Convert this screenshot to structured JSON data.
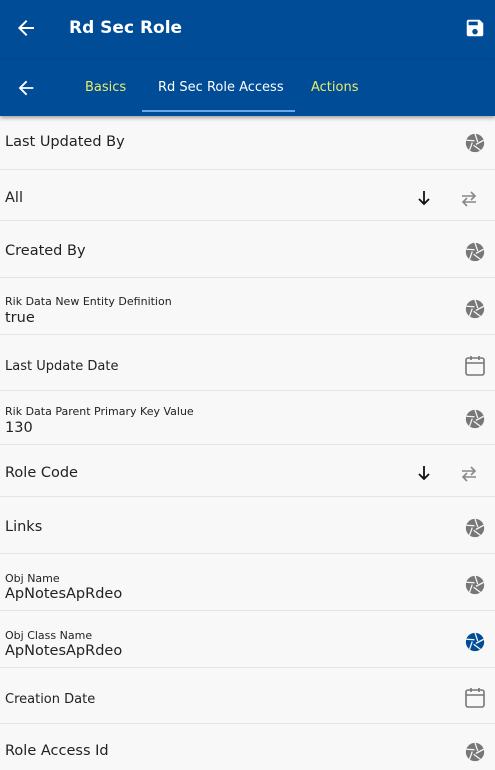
{
  "appbar": {
    "title": "Rd Sec Role",
    "back_icon": "arrow-left-icon",
    "save_icon": "save-icon"
  },
  "tabs": [
    {
      "label": "Basics",
      "active": false
    },
    {
      "label": "Rd Sec Role Access",
      "active": true
    },
    {
      "label": "Actions",
      "active": false
    }
  ],
  "colors": {
    "primary": "#004c97",
    "tab_inactive": "#e8ec6a",
    "tab_indicator": "#6aa6ea",
    "icon_gray": "#777777",
    "icon_active": "#004c97"
  },
  "rows": [
    {
      "label": "Last Updated By"
    },
    {
      "label": "All"
    },
    {
      "label": "Created By"
    },
    {
      "label": "Rik Data New Entity Definition",
      "value": "true"
    },
    {
      "label": "Last Update Date"
    },
    {
      "label": "Rik Data Parent Primary Key Value",
      "value": "130"
    },
    {
      "label": "Role Code"
    },
    {
      "label": "Links"
    },
    {
      "label": "Obj Name",
      "value": "ApNotesApRdeo"
    },
    {
      "label": "Obj Class Name",
      "value": "ApNotesApRdeo"
    },
    {
      "label": "Creation Date"
    },
    {
      "label": "Role Access Id"
    }
  ]
}
